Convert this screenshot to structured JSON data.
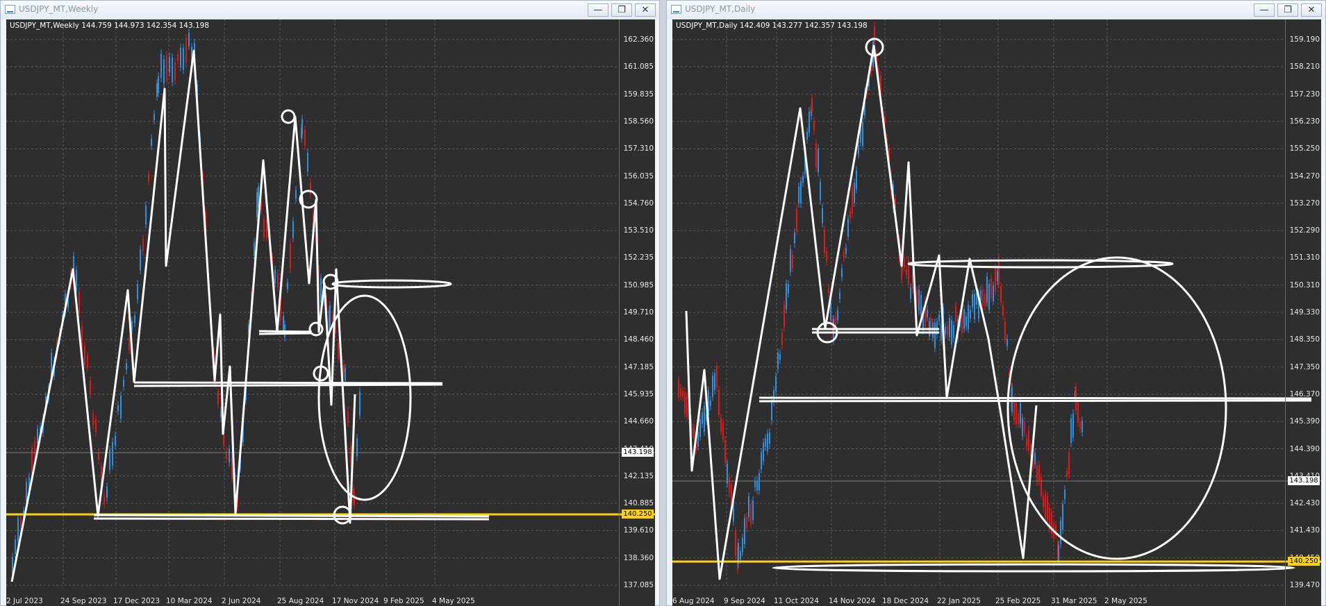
{
  "colors": {
    "up": "#2f8fe0",
    "down": "#e01818",
    "level": "#ffd20a",
    "draw": "#ffffff",
    "grid": "#5a5a5a",
    "bg": "#2e2e2e"
  },
  "icons": {
    "window": "chart-window-icon",
    "minimize": "minimize-icon",
    "maximize": "maximize-icon",
    "close": "close-icon"
  },
  "left": {
    "title": "USDJPY_MT,Weekly",
    "ohlc": "USDJPY_MT,Weekly  144.759 144.973 142.354 143.198",
    "price_labels": [
      "162.360",
      "161.085",
      "159.835",
      "158.560",
      "157.310",
      "156.035",
      "154.760",
      "153.510",
      "152.235",
      "150.985",
      "149.710",
      "148.460",
      "147.185",
      "145.935",
      "144.660",
      "143.410",
      "142.135",
      "140.885",
      "139.610",
      "138.360",
      "137.085"
    ],
    "date_labels": [
      "2 Jul 2023",
      "24 Sep 2023",
      "17 Dec 2023",
      "10 Mar 2024",
      "2 Jun 2024",
      "25 Aug 2024",
      "17 Nov 2024",
      "9 Feb 2025",
      "4 May 2025"
    ],
    "current_price": "143.198",
    "level_price": "140.250"
  },
  "right": {
    "title": "USDJPY_MT,Daily",
    "ohlc": "USDJPY_MT,Daily  142.409 143.277 142.357 143.198",
    "price_labels": [
      "159.190",
      "158.210",
      "157.230",
      "156.230",
      "155.250",
      "154.270",
      "153.270",
      "152.290",
      "151.310",
      "150.310",
      "149.330",
      "148.350",
      "147.350",
      "146.370",
      "145.390",
      "144.390",
      "143.410",
      "142.430",
      "141.430",
      "140.450",
      "139.470"
    ],
    "date_labels": [
      "6 Aug 2024",
      "9 Sep 2024",
      "11 Oct 2024",
      "14 Nov 2024",
      "18 Dec 2024",
      "22 Jan 2025",
      "25 Feb 2025",
      "31 Mar 2025",
      "2 May 2025"
    ],
    "current_price": "143.198",
    "level_price": "140.250"
  }
}
